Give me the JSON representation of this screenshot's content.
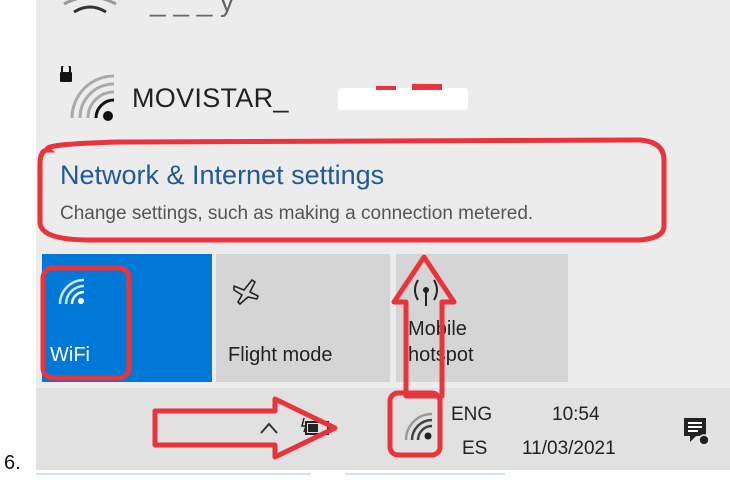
{
  "step_number": "6.",
  "networks": {
    "top_partial_name": "_ _ _ y",
    "secured_network": {
      "ssid": "MOVISTAR_",
      "icon": "wifi-lock-icon"
    }
  },
  "settings_link": {
    "title": "Network & Internet settings",
    "subtitle": "Change settings, such as making a connection metered."
  },
  "quick_actions": [
    {
      "label": "WiFi",
      "icon": "wifi-icon",
      "active": true
    },
    {
      "label": "Flight mode",
      "icon": "airplane-icon",
      "active": false
    },
    {
      "label": "Mobile\nhotspot",
      "icon": "mobile-hotspot-icon",
      "active": false
    }
  ],
  "quick_action_labels": {
    "wifi": "WiFi",
    "flight_mode": "Flight mode",
    "mobile_line1": "Mobile",
    "mobile_line2": "hotspot"
  },
  "taskbar": {
    "language_top": "ENG",
    "language_bottom": "ES",
    "time": "10:54",
    "date": "11/03/2021",
    "icons": [
      "chevron-up-icon",
      "battery-charging-icon",
      "wifi-icon",
      "notification-icon"
    ]
  },
  "annotation_color": "#e8343a",
  "accent_color": "#0078d7",
  "link_color": "#1f5a97"
}
